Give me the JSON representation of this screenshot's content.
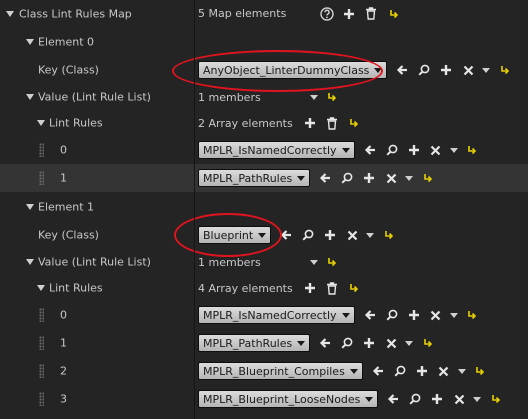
{
  "root": {
    "label": "Class Lint Rules Map",
    "count_text": "5 Map elements"
  },
  "elements": [
    {
      "label": "Element 0",
      "key_label": "Key (Class)",
      "key_value": "AnyObject_LinterDummyClass",
      "value_label": "Value (Lint Rule List)",
      "members_text": "1 members",
      "rules_label": "Lint Rules",
      "rules_count_text": "2 Array elements",
      "items": [
        {
          "index": "0",
          "value": "MPLR_IsNamedCorrectly"
        },
        {
          "index": "1",
          "value": "MPLR_PathRules"
        }
      ]
    },
    {
      "label": "Element 1",
      "key_label": "Key (Class)",
      "key_value": "Blueprint",
      "value_label": "Value (Lint Rule List)",
      "members_text": "1 members",
      "rules_label": "Lint Rules",
      "rules_count_text": "4 Array elements",
      "items": [
        {
          "index": "0",
          "value": "MPLR_IsNamedCorrectly"
        },
        {
          "index": "1",
          "value": "MPLR_PathRules"
        },
        {
          "index": "2",
          "value": "MPLR_Blueprint_Compiles"
        },
        {
          "index": "3",
          "value": "MPLR_Blueprint_LooseNodes"
        }
      ]
    }
  ],
  "icons": {
    "help": "help-icon",
    "add": "plus-icon",
    "remove": "trash-icon",
    "reset": "reset-to-default-icon",
    "use_selected": "use-selected-arrow-icon",
    "browse": "browse-magnifier-icon",
    "clear": "clear-x-icon",
    "menu": "dropdown-arrow-icon"
  },
  "colors": {
    "background": "#242424",
    "alt_row": "#2c2c2c",
    "text": "#c8c8c8",
    "reset_icon": "#e8d000",
    "annotation_circle": "#e0141e"
  }
}
